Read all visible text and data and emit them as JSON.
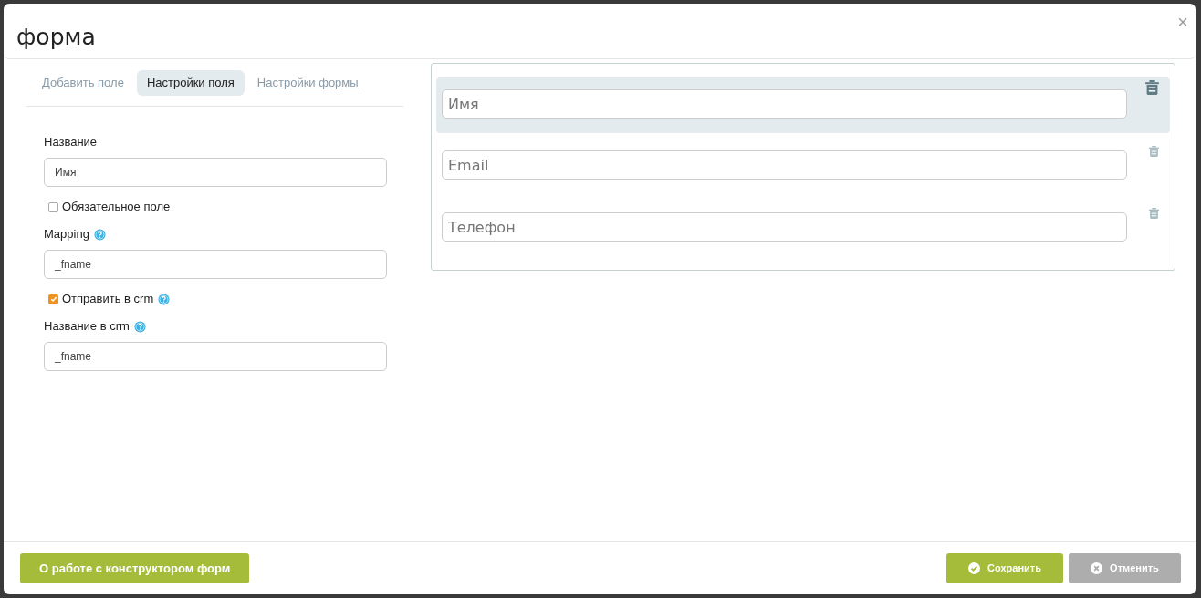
{
  "window": {
    "title": "форма",
    "close": "×"
  },
  "tabs": [
    {
      "label": "Добавить поле",
      "selected": false
    },
    {
      "label": "Настройки поля",
      "selected": true
    },
    {
      "label": "Настройки формы",
      "selected": false
    }
  ],
  "settings": [
    {
      "kind": "field",
      "label": "Название",
      "help": false,
      "value": "Имя"
    },
    {
      "kind": "checkbox",
      "label": "Обязательное поле",
      "help": false,
      "checked": false
    },
    {
      "kind": "field",
      "label": "Mapping",
      "help": true,
      "value": "_fname"
    },
    {
      "kind": "checkbox",
      "label": "Отправить в crm",
      "help": true,
      "checked": true
    },
    {
      "kind": "field",
      "label": "Название в crm",
      "help": true,
      "value": "_fname"
    }
  ],
  "preview_fields": [
    {
      "placeholder": "Имя",
      "selected": true
    },
    {
      "placeholder": "Email",
      "selected": false
    },
    {
      "placeholder": "Телефон",
      "selected": false
    }
  ],
  "footer": {
    "help_button": "О работе с конструктором форм",
    "save_button": "Сохранить",
    "cancel_button": "Отменить"
  }
}
